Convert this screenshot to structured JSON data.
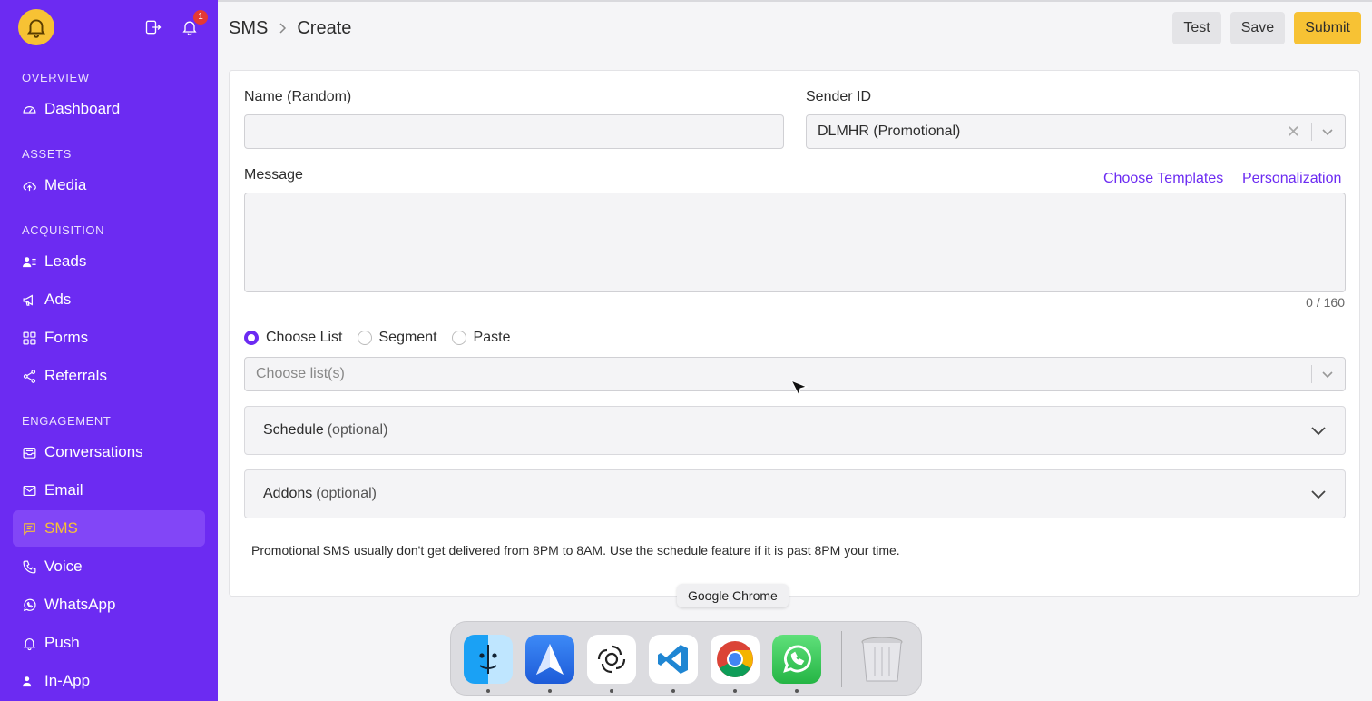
{
  "sidebar": {
    "notification_count": "1",
    "sections": {
      "overview": "OVERVIEW",
      "assets": "ASSETS",
      "acquisition": "ACQUISITION",
      "engagement": "ENGAGEMENT"
    },
    "items": {
      "dashboard": "Dashboard",
      "media": "Media",
      "leads": "Leads",
      "ads": "Ads",
      "forms": "Forms",
      "referrals": "Referrals",
      "conversations": "Conversations",
      "email": "Email",
      "sms": "SMS",
      "voice": "Voice",
      "whatsapp": "WhatsApp",
      "push": "Push",
      "inapp": "In-App"
    },
    "active": "sms"
  },
  "header": {
    "breadcrumb_root": "SMS",
    "breadcrumb_current": "Create",
    "test_label": "Test",
    "save_label": "Save",
    "submit_label": "Submit"
  },
  "form": {
    "name_label": "Name (Random)",
    "name_value": "",
    "sender_label": "Sender ID",
    "sender_value": "DLMHR (Promotional)",
    "message_label": "Message",
    "choose_templates": "Choose Templates",
    "personalization": "Personalization",
    "message_value": "",
    "counter": "0 / 160",
    "radio_options": {
      "list": "Choose List",
      "segment": "Segment",
      "paste": "Paste"
    },
    "radio_selected": "Choose List",
    "list_placeholder": "Choose list(s)",
    "schedule_label": "Schedule",
    "schedule_optional": "(optional)",
    "addons_label": "Addons",
    "addons_optional": "(optional)",
    "note": "Promotional SMS usually don't get delivered from 8PM to 8AM. Use the schedule feature if it is past 8PM your time."
  },
  "dock": {
    "tooltip": "Google Chrome",
    "apps": [
      "Finder",
      "Spark",
      "ChatGPT",
      "Visual Studio Code",
      "Google Chrome",
      "WhatsApp",
      "Trash"
    ]
  },
  "colors": {
    "brand_purple": "#6c2bf2",
    "accent_yellow": "#f7c234"
  }
}
